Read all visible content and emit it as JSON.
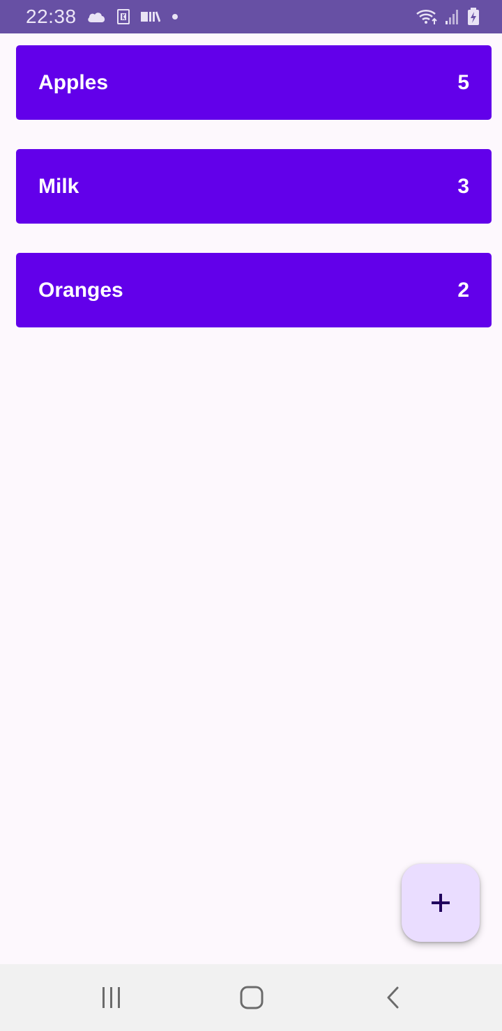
{
  "status_bar": {
    "time": "22:38",
    "left_icons": [
      "cloud-icon",
      "app-notification-icon",
      "library-icon",
      "dot-icon"
    ],
    "right_icons": [
      "wifi-icon",
      "signal-icon",
      "battery-charging-icon"
    ]
  },
  "items": [
    {
      "name": "Apples",
      "quantity": "5"
    },
    {
      "name": "Milk",
      "quantity": "3"
    },
    {
      "name": "Oranges",
      "quantity": "2"
    }
  ],
  "fab": {
    "icon": "plus-icon"
  },
  "nav_bar": {
    "buttons": [
      "recent-apps-icon",
      "home-icon",
      "back-icon"
    ]
  },
  "colors": {
    "status_bar": "#6750a4",
    "item_background": "#6200ea",
    "fab_background": "#eaddff",
    "fab_icon": "#21005d",
    "page_background": "#fdf8fd",
    "nav_bar": "#f1f1f1"
  }
}
